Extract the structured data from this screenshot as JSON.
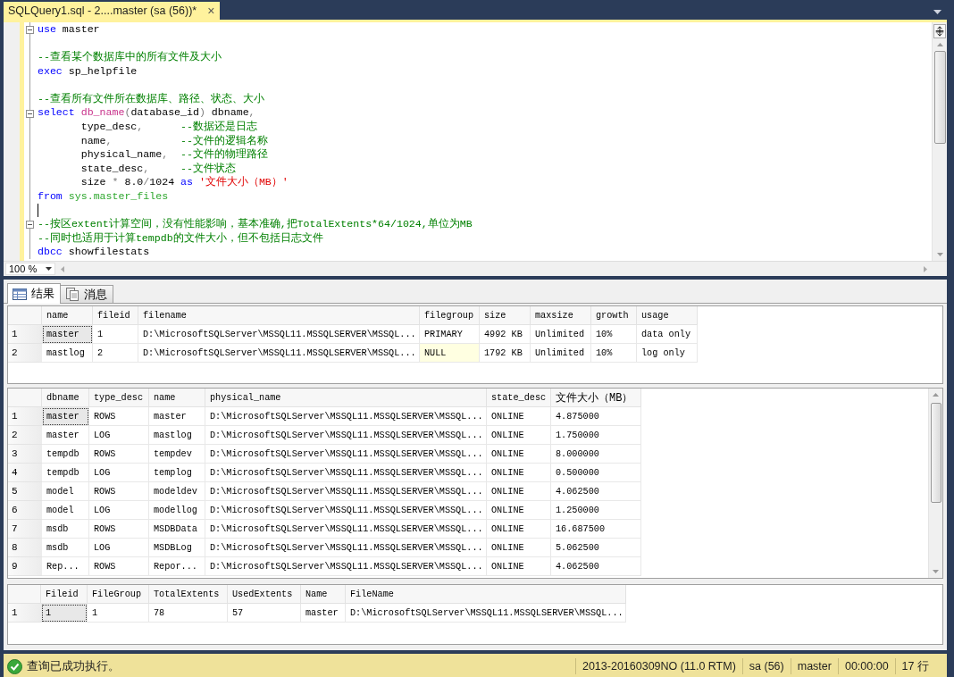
{
  "document_tab": {
    "title": "SQLQuery1.sql - 2....master (sa (56))*",
    "close": "×"
  },
  "editor": {
    "lines": [
      {
        "fold": true,
        "tokens": [
          {
            "t": "use",
            "kind": "keyword"
          },
          {
            "t": " master",
            "kind": "plain"
          }
        ]
      },
      {
        "blank_before": true,
        "tokens": [
          {
            "t": "--查看某个数据库中的所有文件及大小",
            "kind": "comment"
          }
        ]
      },
      {
        "tokens": [
          {
            "t": "exec",
            "kind": "keyword"
          },
          {
            "t": " sp_helpfile",
            "kind": "plain"
          }
        ]
      },
      {
        "blank_before": true,
        "tokens": [
          {
            "t": "--查看所有文件所在数据库、路径、状态、大小",
            "kind": "comment"
          }
        ]
      },
      {
        "fold": true,
        "tokens": [
          {
            "t": "select",
            "kind": "keyword"
          },
          {
            "t": " db_name",
            "kind": "function"
          },
          {
            "t": "(",
            "kind": "operator"
          },
          {
            "t": "database_id",
            "kind": "plain"
          },
          {
            "t": ")",
            "kind": "operator"
          },
          {
            "t": " dbname",
            "kind": "plain"
          },
          {
            "t": ",",
            "kind": "operator"
          }
        ]
      },
      {
        "tokens": [
          {
            "t": "       type_desc",
            "kind": "plain"
          },
          {
            "t": ",",
            "kind": "operator"
          },
          {
            "t": "      --数据还是日志",
            "kind": "comment"
          }
        ]
      },
      {
        "tokens": [
          {
            "t": "       name",
            "kind": "plain"
          },
          {
            "t": ",",
            "kind": "operator"
          },
          {
            "t": "           --文件的逻辑名称",
            "kind": "comment"
          }
        ]
      },
      {
        "tokens": [
          {
            "t": "       physical_name",
            "kind": "plain"
          },
          {
            "t": ",",
            "kind": "operator"
          },
          {
            "t": "  --文件的物理路径",
            "kind": "comment"
          }
        ]
      },
      {
        "tokens": [
          {
            "t": "       state_desc",
            "kind": "plain"
          },
          {
            "t": ",",
            "kind": "operator"
          },
          {
            "t": "     --文件状态",
            "kind": "comment"
          }
        ]
      },
      {
        "tokens": [
          {
            "t": "       size ",
            "kind": "plain"
          },
          {
            "t": "*",
            "kind": "operator"
          },
          {
            "t": " 8.0",
            "kind": "plain"
          },
          {
            "t": "/",
            "kind": "operator"
          },
          {
            "t": "1024 ",
            "kind": "plain"
          },
          {
            "t": "as",
            "kind": "keyword"
          },
          {
            "t": " '文件大小（MB）'",
            "kind": "string"
          }
        ]
      },
      {
        "tokens": [
          {
            "t": "from",
            "kind": "keyword"
          },
          {
            "t": " sys.master_files",
            "kind": "system"
          }
        ]
      },
      {
        "cursor": true
      },
      {
        "fold": true,
        "tokens": [
          {
            "t": "--按区extent计算空间，没有性能影响，基本准确,把TotalExtents*64/1024,单位为MB",
            "kind": "comment"
          }
        ]
      },
      {
        "tokens": [
          {
            "t": "--同时也适用于计算tempdb的文件大小，但不包括日志文件",
            "kind": "comment"
          }
        ]
      },
      {
        "tokens": [
          {
            "t": "dbcc",
            "kind": "keyword"
          },
          {
            "t": " showfilestats",
            "kind": "plain"
          }
        ]
      }
    ],
    "zoom": "100 %"
  },
  "result_tabs": [
    {
      "label": "结果",
      "selected": true,
      "kind": "grid"
    },
    {
      "label": "消息",
      "selected": false,
      "kind": "messages"
    }
  ],
  "grids": [
    {
      "columns": [
        "name",
        "fileid",
        "filename",
        "filegroup",
        "size",
        "maxsize",
        "growth",
        "usage"
      ],
      "rows": [
        {
          "number": "1",
          "selected": true,
          "cells": [
            "master",
            "1",
            "D:\\MicrosoftSQLServer\\MSSQL11.MSSQLSERVER\\MSSQL...",
            "PRIMARY",
            "4992 KB",
            "Unlimited",
            "10%",
            "data only"
          ]
        },
        {
          "number": "2",
          "selected": false,
          "cells": [
            "mastlog",
            "2",
            "D:\\MicrosoftSQLServer\\MSSQL11.MSSQLSERVER\\MSSQL...",
            {
              "text": "NULL",
              "kind": "null"
            },
            "1792 KB",
            "Unlimited",
            "10%",
            "log only"
          ]
        }
      ]
    },
    {
      "columns": [
        "dbname",
        "type_desc",
        "name",
        "physical_name",
        "state_desc",
        "文件大小（MB）"
      ],
      "rows": [
        {
          "number": "1",
          "selected": true,
          "cells": [
            "master",
            "ROWS",
            "master",
            "D:\\MicrosoftSQLServer\\MSSQL11.MSSQLSERVER\\MSSQL...",
            "ONLINE",
            "4.875000"
          ]
        },
        {
          "number": "2",
          "selected": false,
          "cells": [
            "master",
            "LOG",
            "mastlog",
            "D:\\MicrosoftSQLServer\\MSSQL11.MSSQLSERVER\\MSSQL...",
            "ONLINE",
            "1.750000"
          ]
        },
        {
          "number": "3",
          "selected": false,
          "cells": [
            "tempdb",
            "ROWS",
            "tempdev",
            "D:\\MicrosoftSQLServer\\MSSQL11.MSSQLSERVER\\MSSQL...",
            "ONLINE",
            "8.000000"
          ]
        },
        {
          "number": "4",
          "selected": false,
          "cells": [
            "tempdb",
            "LOG",
            "templog",
            "D:\\MicrosoftSQLServer\\MSSQL11.MSSQLSERVER\\MSSQL...",
            "ONLINE",
            "0.500000"
          ]
        },
        {
          "number": "5",
          "selected": false,
          "cells": [
            "model",
            "ROWS",
            "modeldev",
            "D:\\MicrosoftSQLServer\\MSSQL11.MSSQLSERVER\\MSSQL...",
            "ONLINE",
            "4.062500"
          ]
        },
        {
          "number": "6",
          "selected": false,
          "cells": [
            "model",
            "LOG",
            "modellog",
            "D:\\MicrosoftSQLServer\\MSSQL11.MSSQLSERVER\\MSSQL...",
            "ONLINE",
            "1.250000"
          ]
        },
        {
          "number": "7",
          "selected": false,
          "cells": [
            "msdb",
            "ROWS",
            "MSDBData",
            "D:\\MicrosoftSQLServer\\MSSQL11.MSSQLSERVER\\MSSQL...",
            "ONLINE",
            "16.687500"
          ]
        },
        {
          "number": "8",
          "selected": false,
          "cells": [
            "msdb",
            "LOG",
            "MSDBLog",
            "D:\\MicrosoftSQLServer\\MSSQL11.MSSQLSERVER\\MSSQL...",
            "ONLINE",
            "5.062500"
          ]
        },
        {
          "number": "9",
          "selected": false,
          "cells": [
            "Rep...",
            "ROWS",
            "Repor...",
            "D:\\MicrosoftSQLServer\\MSSQL11.MSSQLSERVER\\MSSQL...",
            "ONLINE",
            "4.062500"
          ]
        }
      ]
    },
    {
      "columns": [
        "Fileid",
        "FileGroup",
        "TotalExtents",
        "UsedExtents",
        "Name",
        "FileName"
      ],
      "rows": [
        {
          "number": "1",
          "selected": true,
          "cells": [
            "1",
            "1",
            "78",
            "57",
            "master",
            "D:\\MicrosoftSQLServer\\MSSQL11.MSSQLSERVER\\MSSQL..."
          ]
        }
      ]
    }
  ],
  "status_bar": {
    "message": "查询已成功执行。",
    "server": "2013-20160309NO (11.0 RTM)",
    "login": "sa (56)",
    "database": "master",
    "elapsed": "00:00:00",
    "row_count": "17 行"
  }
}
